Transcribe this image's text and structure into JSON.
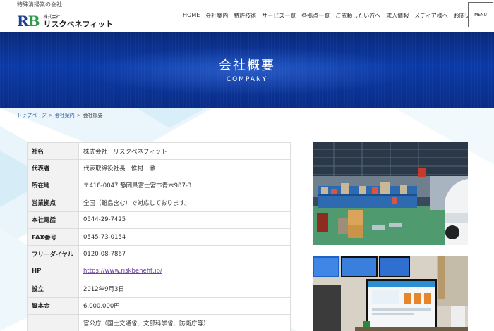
{
  "header": {
    "tagline": "特殊清掃業の会社",
    "logo_mark_r": "R",
    "logo_mark_b": "B",
    "logo_kabu": "株式会社",
    "logo_name": "リスクベネフィット",
    "nav": [
      "HOME",
      "会社案内",
      "特許技術",
      "サービス一覧",
      "各拠点一覧",
      "ご依頼したい方へ",
      "求人情報",
      "メディア様へ",
      "お問い合"
    ],
    "menu_label": "MENU"
  },
  "hero": {
    "title": "会社概要",
    "subtitle": "COMPANY"
  },
  "breadcrumb": {
    "items": [
      "トップページ",
      "会社案内",
      "会社概要"
    ],
    "separator": ">"
  },
  "company_table": {
    "rows": [
      {
        "label": "社名",
        "value": "株式会社　リスクベネフィット"
      },
      {
        "label": "代表者",
        "value": "代表取締役社長　惟村　徹"
      },
      {
        "label": "所在地",
        "value": "〒418-0047 静岡県富士宮市青木987-3"
      },
      {
        "label": "営業拠点",
        "value": "全国（離島含む）で対応しております。"
      },
      {
        "label": "本社電話",
        "value": "0544-29-7425"
      },
      {
        "label": "FAX番号",
        "value": "0545-73-0154"
      },
      {
        "label": "フリーダイヤル",
        "value": "0120-08-7867"
      },
      {
        "label": "HP",
        "value": "https://www.riskbenefit.jp/"
      },
      {
        "label": "設立",
        "value": "2012年9月3日"
      },
      {
        "label": "資本金",
        "value": "6,000,000円"
      },
      {
        "label": "",
        "value": "官公庁（国土交通省、文部科学省、防衛庁等）"
      }
    ]
  },
  "colors": {
    "hero_blue": "#0b3aa8",
    "logo_blue": "#1f3f8f",
    "logo_green": "#2e9b4a",
    "link_purple": "#6a3fa0",
    "breadcrumb_link": "#2a5caa"
  }
}
